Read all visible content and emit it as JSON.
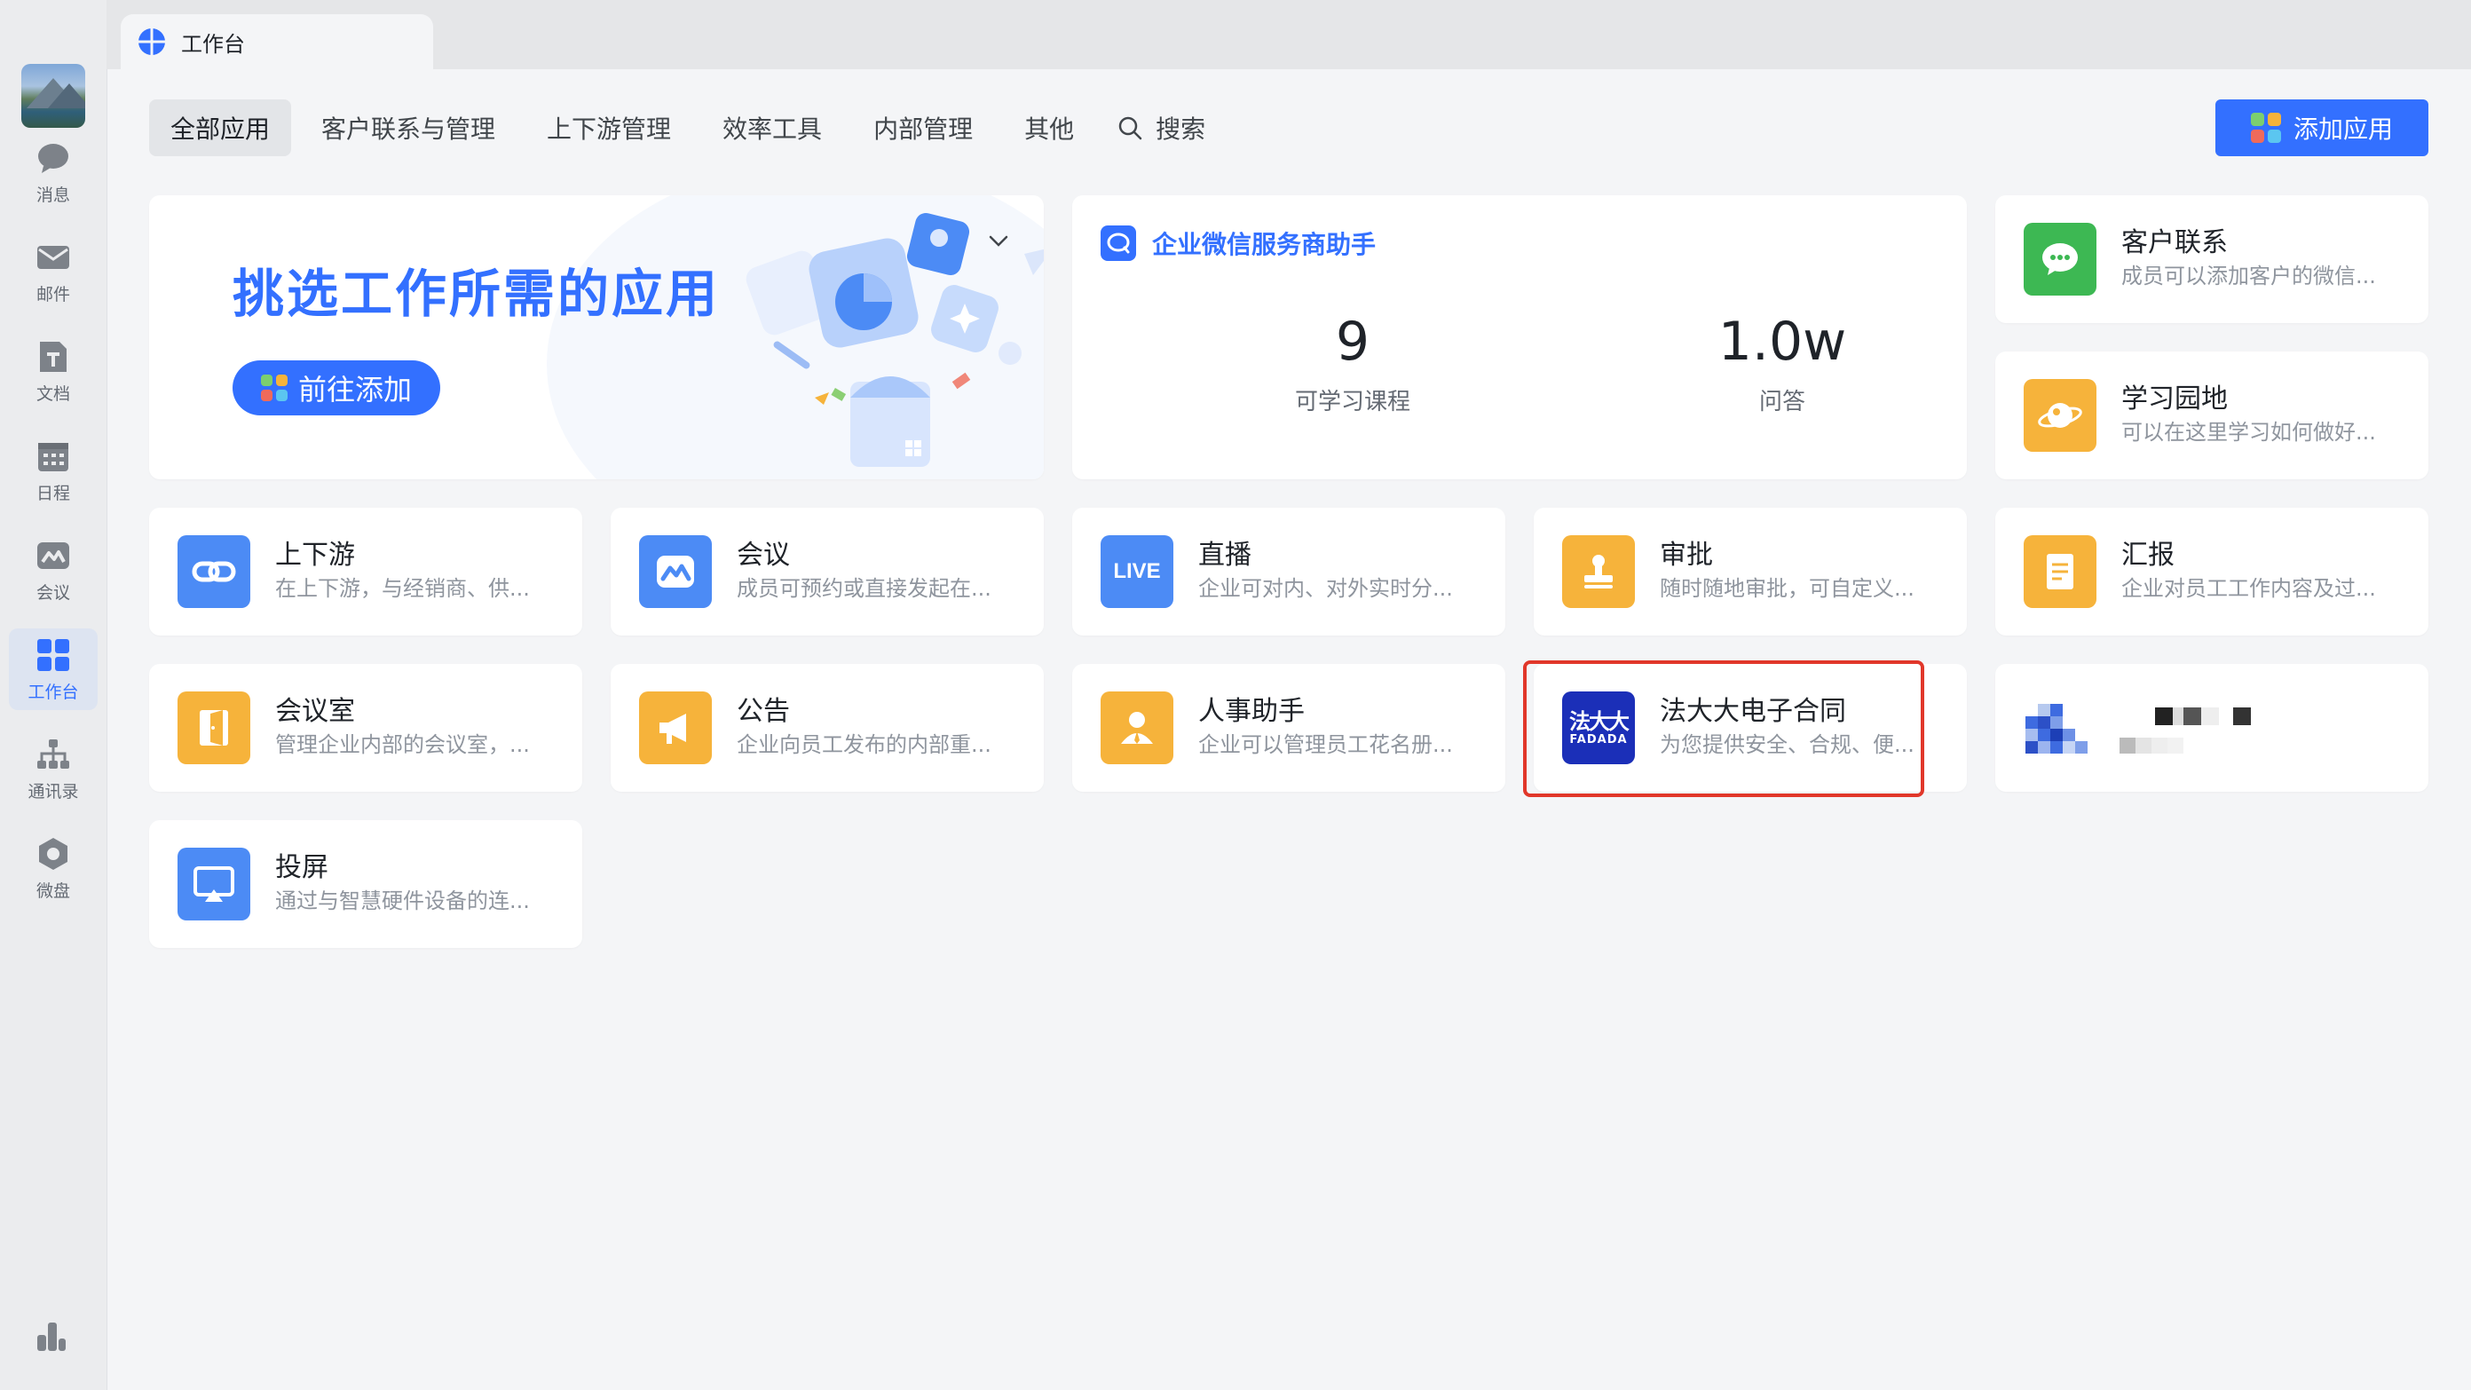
{
  "window": {
    "tab_title": "工作台"
  },
  "sidebar": {
    "items": [
      {
        "key": "messages",
        "label": "消息",
        "icon": "message-bubble-icon"
      },
      {
        "key": "mail",
        "label": "邮件",
        "icon": "mail-envelope-icon"
      },
      {
        "key": "docs",
        "label": "文档",
        "icon": "document-icon"
      },
      {
        "key": "calendar",
        "label": "日程",
        "icon": "calendar-icon"
      },
      {
        "key": "meeting",
        "label": "会议",
        "icon": "meeting-icon"
      },
      {
        "key": "workbench",
        "label": "工作台",
        "icon": "workbench-grid-icon",
        "active": true
      },
      {
        "key": "contacts",
        "label": "通讯录",
        "icon": "contacts-org-icon"
      },
      {
        "key": "drive",
        "label": "微盘",
        "icon": "drive-icon"
      }
    ]
  },
  "categories": [
    "全部应用",
    "客户联系与管理",
    "上下游管理",
    "效率工具",
    "内部管理",
    "其他"
  ],
  "search_label": "搜索",
  "add_app_label": "添加应用",
  "banner": {
    "title": "挑选工作所需的应用",
    "button": "前往添加"
  },
  "helper": {
    "title": "企业微信服务商助手",
    "stats": [
      {
        "value": "9",
        "caption": "可学习课程"
      },
      {
        "value": "1.0w",
        "caption": "问答"
      }
    ]
  },
  "apps": {
    "customer": {
      "name": "客户联系",
      "desc": "成员可以添加客户的微信..."
    },
    "learning": {
      "name": "学习园地",
      "desc": "可以在这里学习如何做好..."
    },
    "updown": {
      "name": "上下游",
      "desc": "在上下游，与经销商、供..."
    },
    "meeting": {
      "name": "会议",
      "desc": "成员可预约或直接发起在..."
    },
    "live": {
      "name": "直播",
      "desc": "企业可对内、对外实时分...",
      "icon_text": "LIVE"
    },
    "approval": {
      "name": "审批",
      "desc": "随时随地审批，可自定义..."
    },
    "report": {
      "name": "汇报",
      "desc": "企业对员工工作内容及过..."
    },
    "room": {
      "name": "会议室",
      "desc": "管理企业内部的会议室，..."
    },
    "notice": {
      "name": "公告",
      "desc": "企业向员工发布的内部重..."
    },
    "hr": {
      "name": "人事助手",
      "desc": "企业可以管理员工花名册..."
    },
    "fadada": {
      "name": "法大大电子合同",
      "desc": "为您提供安全、合规、便...",
      "logo_cn": "法大大",
      "logo_en": "FADADA"
    },
    "cast": {
      "name": "投屏",
      "desc": "通过与智慧硬件设备的连..."
    }
  },
  "colors": {
    "accent": "#3370ff",
    "green": "#3db853",
    "orange": "#f6b33b",
    "blue_icon": "#4c8bf5",
    "fadada": "#1b2fb8",
    "highlight": "#e1372a"
  }
}
